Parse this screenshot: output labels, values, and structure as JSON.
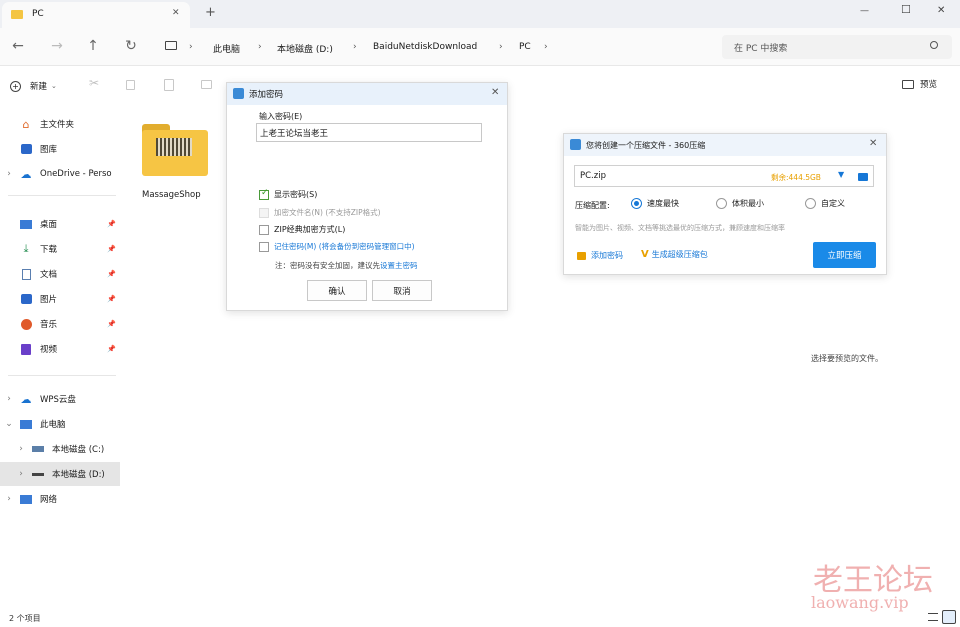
{
  "window": {
    "tab_title": "PC",
    "new_tab": "+",
    "minimize": "—",
    "maximize": "☐",
    "close": "✕"
  },
  "nav": {
    "breadcrumbs": [
      "此电脑",
      "本地磁盘 (D:)",
      "BaiduNetdiskDownload",
      "PC"
    ],
    "search_placeholder": "在 PC 中搜索"
  },
  "toolbar": {
    "new_label": "新建",
    "preview_label": "预览"
  },
  "sidebar": {
    "quick": [
      {
        "label": "主文件夹",
        "icon": "home-icon"
      },
      {
        "label": "图库",
        "icon": "gallery-icon"
      },
      {
        "label": "OneDrive - Perso",
        "icon": "cloud-icon"
      }
    ],
    "pinned": [
      {
        "label": "桌面",
        "icon": "desktop-icon"
      },
      {
        "label": "下载",
        "icon": "download-icon"
      },
      {
        "label": "文档",
        "icon": "document-icon"
      },
      {
        "label": "图片",
        "icon": "picture-icon"
      },
      {
        "label": "音乐",
        "icon": "music-icon"
      },
      {
        "label": "视频",
        "icon": "video-icon"
      }
    ],
    "tree": [
      {
        "label": "WPS云盘",
        "icon": "cloud-icon"
      },
      {
        "label": "此电脑",
        "icon": "computer-icon"
      },
      {
        "label": "本地磁盘 (C:)",
        "icon": "drive-icon"
      },
      {
        "label": "本地磁盘 (D:)",
        "icon": "drive-icon"
      },
      {
        "label": "网络",
        "icon": "network-icon"
      }
    ]
  },
  "content": {
    "folder_name": "MassageShop",
    "preview_hint": "选择要预览的文件。"
  },
  "status": {
    "item_count": "2 个项目"
  },
  "password_dialog": {
    "title": "添加密码",
    "input_label": "输入密码(E)",
    "password_value": "上老王论坛当老王",
    "show_password": "显示密码(S)",
    "encrypt_names": "加密文件名(N) (不支持ZIP格式)",
    "zip_classic": "ZIP经典加密方式(L)",
    "remember": "记住密码(M) (将会备份到密码管理窗口中)",
    "note_prefix": "注：密码没有安全加固，建议先",
    "note_link": "设置主密码",
    "ok": "确认",
    "cancel": "取消"
  },
  "compress_dialog": {
    "title": "您将创建一个压缩文件 - 360压缩",
    "filename": "PC.zip",
    "space_left": "剩余:444.5GB",
    "config_label": "压缩配置:",
    "options": [
      "速度最快",
      "体积最小",
      "自定义"
    ],
    "desc": "智能为图片、视频、文档等挑选最优的压缩方式，兼顾速度和压缩率",
    "add_password": "添加密码",
    "super_archive": "生成超级压缩包",
    "compress_now": "立即压缩"
  },
  "watermark": {
    "cn": "老王论坛",
    "url": "laowang.vip"
  },
  "colors": {
    "accent": "#1677d6",
    "primary_button": "#1a8ae8",
    "orange": "#e8a000",
    "folder": "#f4c542",
    "watermark": "#f0b0b0"
  }
}
